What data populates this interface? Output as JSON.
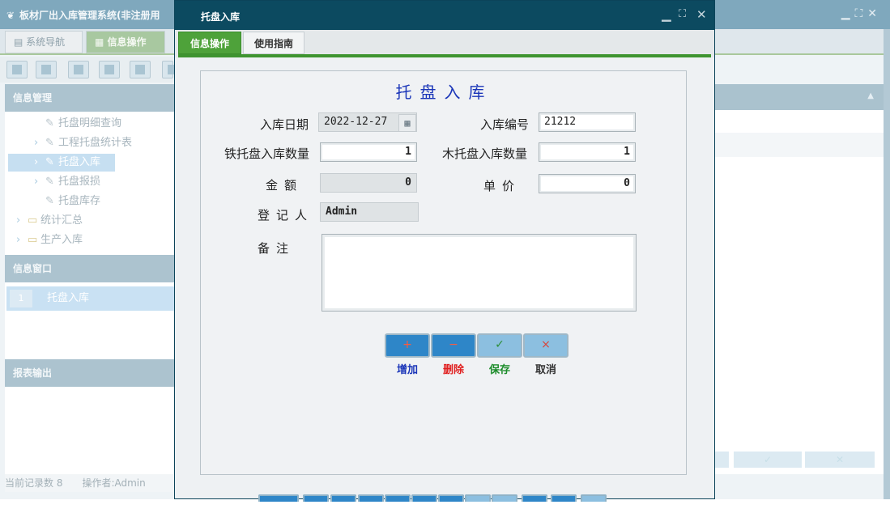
{
  "background": {
    "app_title": "板材厂出入库管理系统(非注册用",
    "tabs": [
      {
        "label": "系统导航",
        "active": false
      },
      {
        "label": "信息操作",
        "active": true
      }
    ],
    "sidebar": {
      "section_info": "信息管理",
      "tree": [
        {
          "label": "托盘明细查询",
          "arrow": "",
          "type": "leaf"
        },
        {
          "label": "工程托盘统计表",
          "arrow": "›",
          "type": "leaf"
        },
        {
          "label": "托盘入库",
          "arrow": "›",
          "type": "leaf",
          "selected": true
        },
        {
          "label": "托盘报损",
          "arrow": "›",
          "type": "leaf"
        },
        {
          "label": "托盘库存",
          "arrow": "",
          "type": "leaf"
        },
        {
          "label": "统计汇总",
          "arrow": "›",
          "type": "folder"
        },
        {
          "label": "生产入库",
          "arrow": "›",
          "type": "folder"
        }
      ],
      "section_window": "信息窗口",
      "window_item": "托盘入库",
      "window_item_num": "1",
      "section_report": "报表输出"
    },
    "status": {
      "record_count": "当前记录数 8",
      "operator": "操作者:Admin"
    }
  },
  "dialog": {
    "title": "托盘入库",
    "tabs": [
      {
        "label": "信息操作",
        "active": true
      },
      {
        "label": "使用指南",
        "active": false
      }
    ],
    "form": {
      "heading": "托盘入库",
      "date_label": "入库日期",
      "date_value": "2022-12-27",
      "code_label": "入库编号",
      "code_value": "21212",
      "iron_label": "铁托盘入库数量",
      "iron_value": "1",
      "wood_label": "木托盘入库数量",
      "wood_value": "1",
      "amount_label": "金额",
      "amount_value": "0",
      "price_label": "单价",
      "price_value": "0",
      "recorder_label": "登记人",
      "recorder_value": "Admin",
      "remarks_label": "备注",
      "remarks_value": ""
    },
    "actions": {
      "add_label": "增加",
      "delete_label": "删除",
      "save_label": "保存",
      "cancel_label": "取消",
      "add_glyph": "+",
      "delete_glyph": "−",
      "save_glyph": "✓",
      "cancel_glyph": "×"
    }
  },
  "colors": {
    "dialog_titlebar": "#0c4a60",
    "active_tab": "#4ea23a",
    "form_heading": "#1a35b8",
    "button_blue": "#2e86c8"
  }
}
